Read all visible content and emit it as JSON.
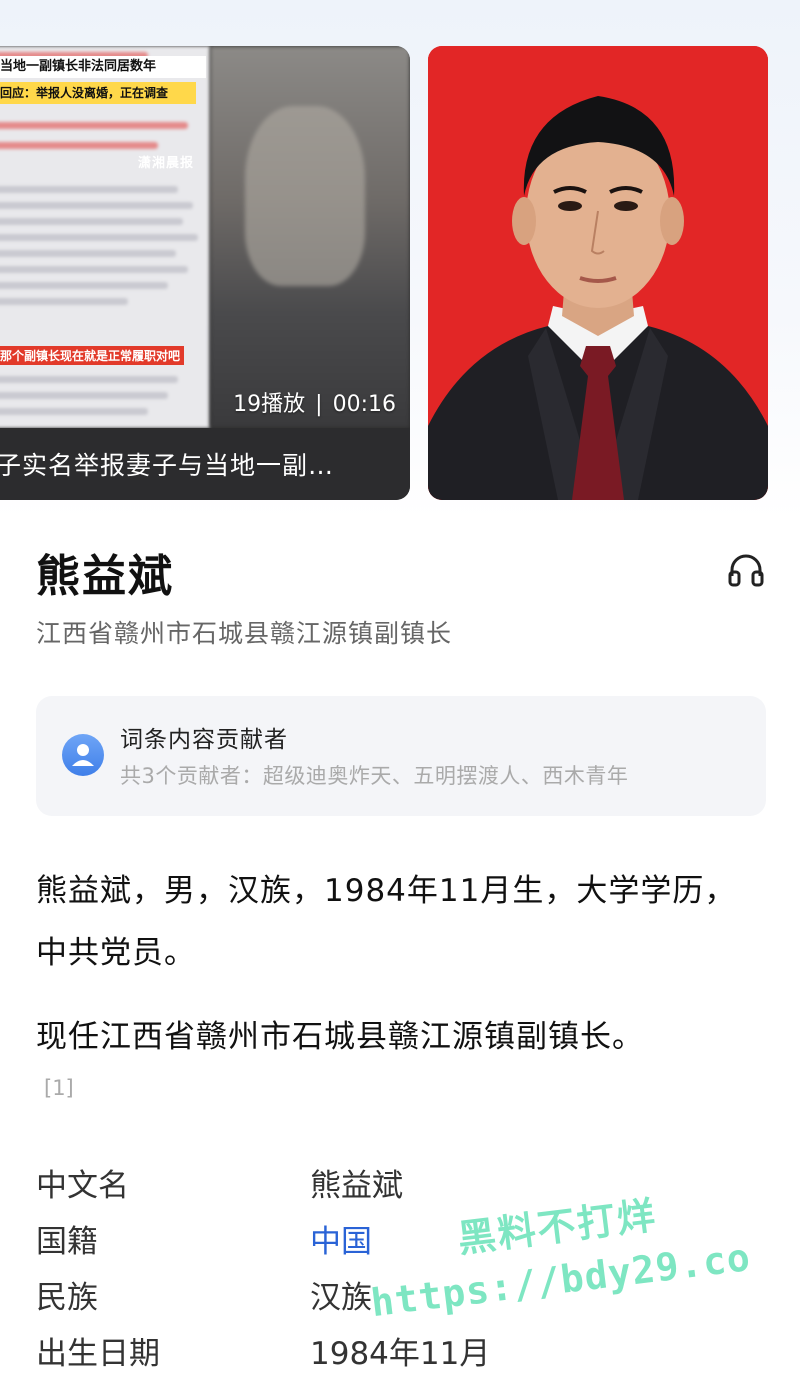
{
  "video": {
    "headline_lines": [
      "当地一副镇长非法同居数年",
      "回应：举报人没离婚，正在调查"
    ],
    "middle_caption": "那个副镇长现在就是正常履职对吧",
    "logo_text": "潇湘晨报",
    "play_count": "19播放",
    "separator": "|",
    "duration": "00:16",
    "caption": "子实名举报妻子与当地一副…"
  },
  "colors": {
    "portrait_bg": "#e22626",
    "link": "#2a63d6",
    "watermark": "#7ee6c2"
  },
  "entry": {
    "name": "熊益斌",
    "subtitle": "江西省赣州市石城县赣江源镇副镇长",
    "audio_icon": "headphones-icon"
  },
  "contributors": {
    "title": "词条内容贡献者",
    "list": "共3个贡献者：超级迪奥炸天、五明摆渡人、西木青年"
  },
  "summary": {
    "paragraph1": "熊益斌，男，汉族，1984年11月生，大学学历，中共党员。",
    "paragraph2": "现任江西省赣州市石城县赣江源镇副镇长。",
    "ref": "[1]"
  },
  "info": [
    {
      "key": "中文名",
      "value": "熊益斌"
    },
    {
      "key": "国籍",
      "value": "中国"
    },
    {
      "key": "民族",
      "value": "汉族"
    },
    {
      "key": "出生日期",
      "value": "1984年11月"
    }
  ],
  "watermark": {
    "line1": "黑料不打烊",
    "line2": "https://bdy29.co"
  }
}
